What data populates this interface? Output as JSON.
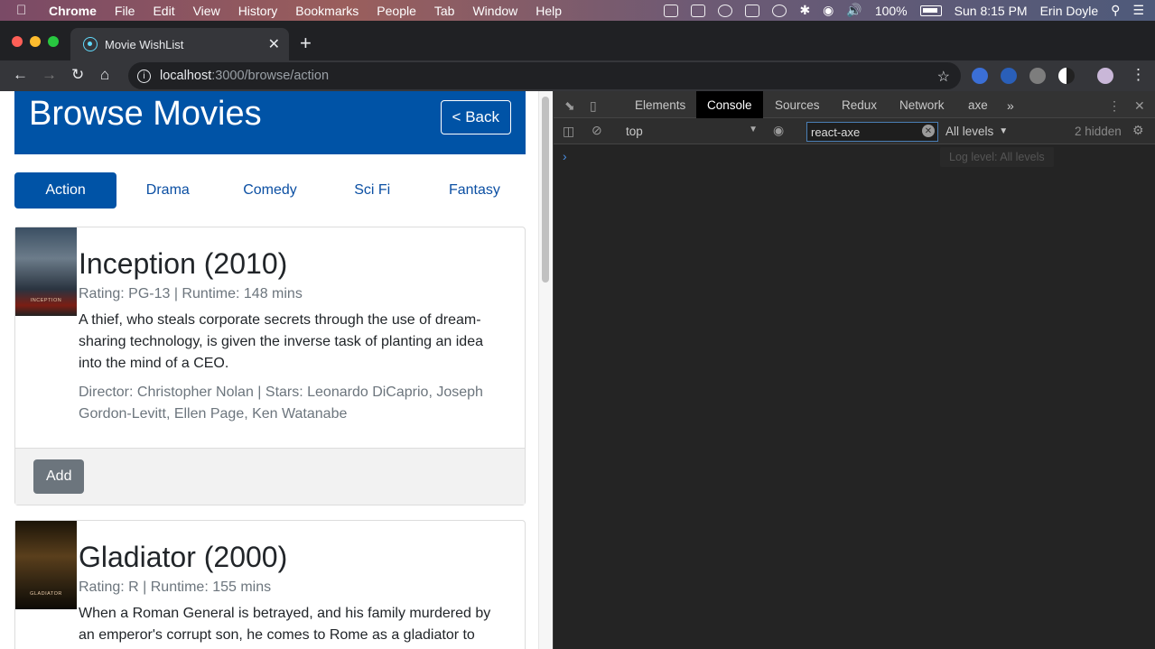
{
  "menubar": {
    "app": "Chrome",
    "items": [
      "File",
      "Edit",
      "View",
      "History",
      "Bookmarks",
      "People",
      "Tab",
      "Window",
      "Help"
    ],
    "battery": "100%",
    "clock": "Sun 8:15 PM",
    "user": "Erin Doyle"
  },
  "browser": {
    "tab_title": "Movie WishList",
    "url_host": "localhost",
    "url_path": ":3000/browse/action"
  },
  "page": {
    "title": "Browse Movies",
    "back_label": "< Back",
    "genres": [
      "Action",
      "Drama",
      "Comedy",
      "Sci Fi",
      "Fantasy"
    ],
    "active_genre": "Action",
    "movies": [
      {
        "title": "Inception (2010)",
        "meta": "Rating: PG-13 | Runtime: 148 mins",
        "description": "A thief, who steals corporate secrets through the use of dream-sharing technology, is given the inverse task of planting an idea into the mind of a CEO.",
        "credits": "Director: Christopher Nolan | Stars: Leonardo DiCaprio, Joseph Gordon-Levitt, Ellen Page, Ken Watanabe",
        "poster_text": "INCEPTION",
        "add_label": "Add"
      },
      {
        "title": "Gladiator (2000)",
        "meta": "Rating: R | Runtime: 155 mins",
        "description": "When a Roman General is betrayed, and his family murdered by an emperor's corrupt son, he comes to Rome as a gladiator to",
        "poster_text": "GLADIATOR"
      }
    ]
  },
  "devtools": {
    "tabs": [
      "Elements",
      "Console",
      "Sources",
      "Redux",
      "Network",
      "axe"
    ],
    "active_tab": "Console",
    "context": "top",
    "filter_value": "react-axe",
    "levels": "All levels",
    "hidden": "2 hidden",
    "tooltip": "Log level: All levels",
    "prompt": "›"
  }
}
